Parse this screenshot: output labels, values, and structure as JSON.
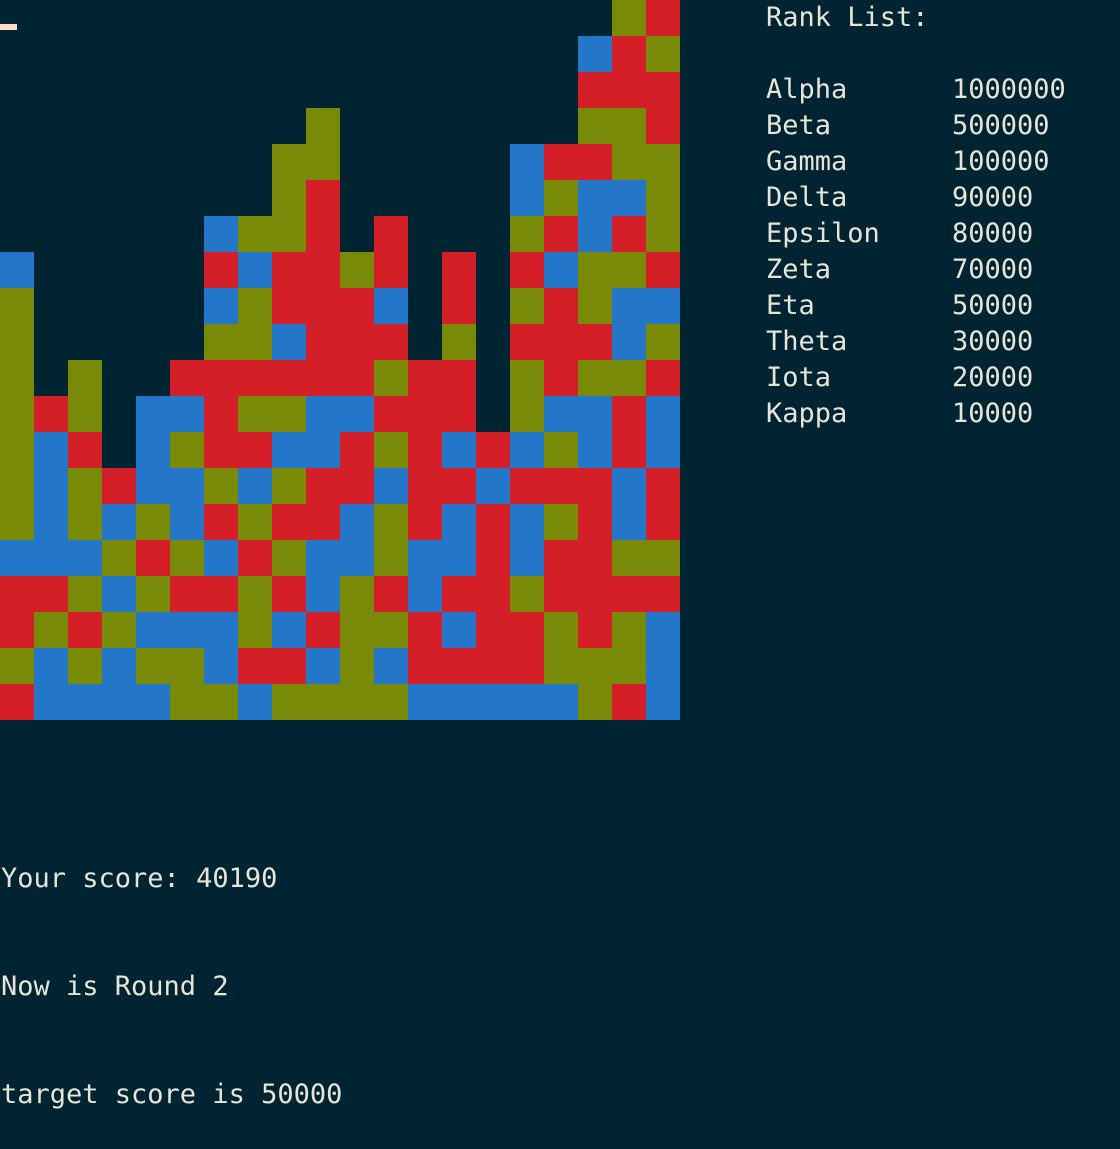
{
  "colors": {
    "background": "#002432",
    "text": "#e8e4d8",
    "R": "#d41f28",
    "G": "#788a07",
    "B": "#2376c8",
    "cursor": "#ffd9cc"
  },
  "board": {
    "columns": 20,
    "rows": [
      "..................GR",
      ".................BRG",
      ".................RRR",
      ".........G.......GGR",
      "........GG.....BRRGG",
      "........GR.....BGBBG",
      "......BGGR.R...GRBRG",
      "B.....RBRRGR.R.RBGGR",
      "G.....BGRRRB.R.GRGBB",
      "G.....GGBRRR.G.RRRBG",
      "G.G..RRRRRRGRR.GRGGR",
      "GRG.BBRGGBBRRR.GBBRB",
      "GBR.BGRRBBRGRBRBGBRB",
      "GBGRBBGBGRRBRRBRRRBR",
      "GBGBGBRGRRBGRBRBGRBR",
      "BBBGRGBRGBBGBBRBRRGG",
      "RRGBGRRGRBGRBRRGRRRR",
      "RGRGBBBGBRGGRBRRGRGB",
      "GBGBGGBRRBGBRRRRGGGB",
      "RBBBBGGBGGGGBBBBBGRB"
    ]
  },
  "rank_list": {
    "title": "Rank List:",
    "entries": [
      {
        "name": "Alpha",
        "score": "1000000"
      },
      {
        "name": "Beta",
        "score": "500000"
      },
      {
        "name": "Gamma",
        "score": "100000"
      },
      {
        "name": "Delta",
        "score": "90000"
      },
      {
        "name": "Epsilon",
        "score": "80000"
      },
      {
        "name": "Zeta",
        "score": "70000"
      },
      {
        "name": "Eta",
        "score": "50000"
      },
      {
        "name": "Theta",
        "score": "30000"
      },
      {
        "name": "Iota",
        "score": "20000"
      },
      {
        "name": "Kappa",
        "score": "10000"
      }
    ]
  },
  "status": {
    "score_line": "Your score: 40190",
    "round_line": "Now is Round 2",
    "target_line": "target score is 50000"
  }
}
